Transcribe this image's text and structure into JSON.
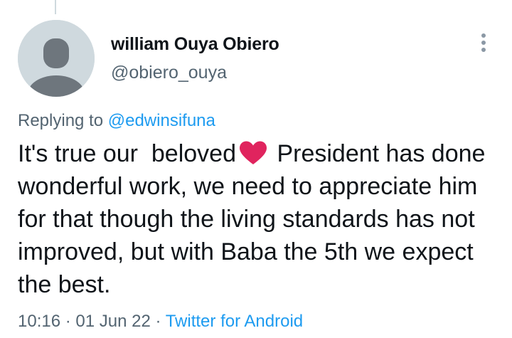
{
  "author": {
    "display_name": "william Ouya Obiero",
    "handle": "@obiero_ouya"
  },
  "reply": {
    "prefix": "Replying to ",
    "to_handle": "@edwinsifuna"
  },
  "tweet": {
    "text_before_emoji": "It's true our  beloved",
    "emoji": "red-heart",
    "text_after_emoji": "President has done wonderful work, we need to appreciate him for that though the living standards has not improved, but with Baba the 5th we expect the best."
  },
  "meta": {
    "time": "10:16",
    "sep1": " · ",
    "date": "01 Jun 22",
    "sep2": " · ",
    "source": "Twitter for Android"
  },
  "colors": {
    "accent": "#1d9bf0",
    "secondary_text": "#536471",
    "heart": "#e0245e",
    "avatar_bg": "#cfd9de",
    "avatar_fg": "#6e767d"
  },
  "icons": {
    "more": "more-vertical-icon",
    "avatar": "default-avatar-icon"
  }
}
